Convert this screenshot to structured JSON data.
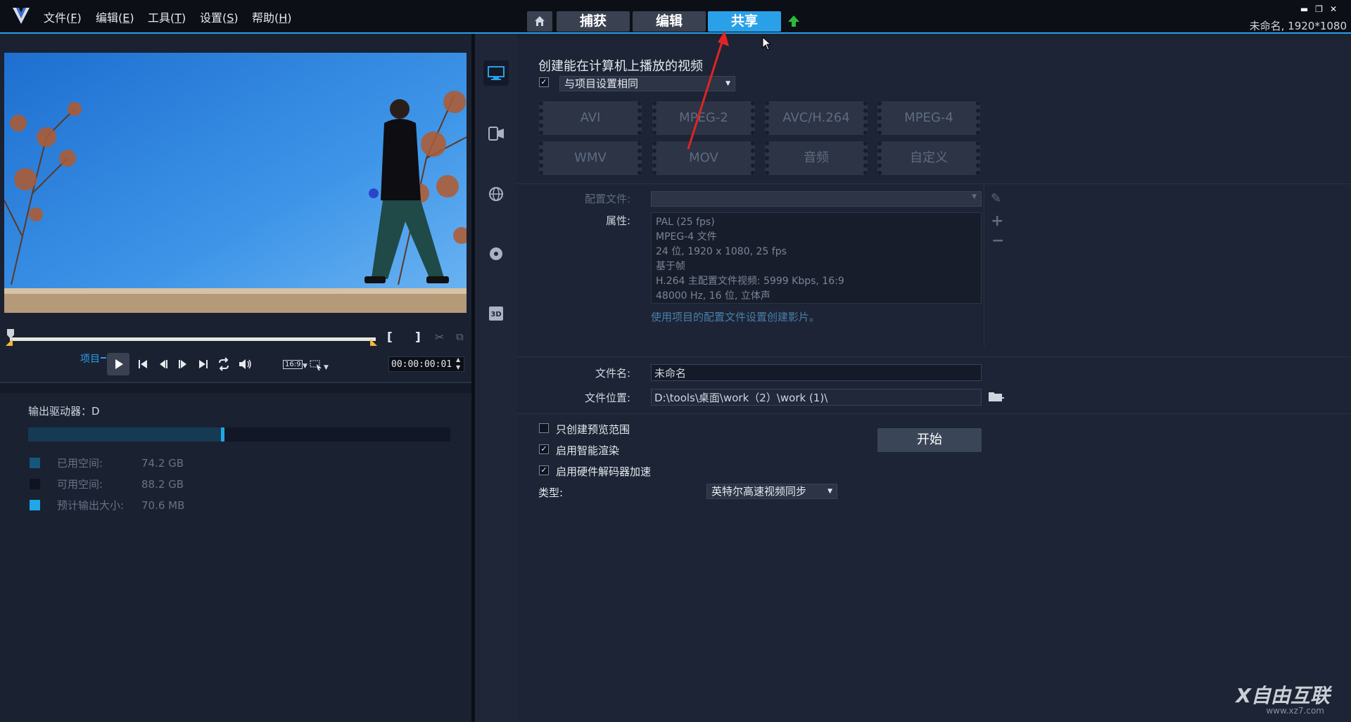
{
  "menu": [
    {
      "label": "文件(",
      "key": "F",
      "end": ")"
    },
    {
      "label": "编辑(",
      "key": "E",
      "end": ")"
    },
    {
      "label": "工具(",
      "key": "T",
      "end": ")"
    },
    {
      "label": "设置(",
      "key": "S",
      "end": ")"
    },
    {
      "label": "帮助(",
      "key": "H",
      "end": ")"
    }
  ],
  "tabs": {
    "capture": "捕获",
    "edit": "编辑",
    "share": "共享"
  },
  "project_info": "未命名, 1920*1080",
  "player": {
    "project_label": "项目",
    "aspect": "16:9",
    "timecode": "00:00:00:01"
  },
  "drive": {
    "title": "输出驱动器：D",
    "used_fraction": 0.457,
    "used_label": "已用空间:",
    "used_value": "74.2 GB",
    "free_label": "可用空间:",
    "free_value": "88.2 GB",
    "est_label": "预计输出大小:",
    "est_value": "70.6 MB"
  },
  "share": {
    "heading": "创建能在计算机上播放的视频",
    "same_as_project": "与项目设置相同",
    "formats": [
      "AVI",
      "MPEG-2",
      "AVC/H.264",
      "MPEG-4",
      "WMV",
      "MOV",
      "音频",
      "自定义"
    ],
    "profile_label": "配置文件:",
    "props_label": "属性:",
    "props": [
      "PAL (25 fps)",
      "MPEG-4 文件",
      "24 位, 1920 x 1080, 25 fps",
      "基于帧",
      "H.264 主配置文件视频: 5999 Kbps, 16:9",
      "48000 Hz, 16 位, 立体声"
    ],
    "props_hint": "使用项目的配置文件设置创建影片。",
    "filename_label": "文件名:",
    "filename_value": "未命名",
    "location_label": "文件位置:",
    "location_value": "D:\\tools\\桌面\\work（2）\\work (1)\\",
    "opt_preview_range": "只创建预览范围",
    "opt_smart_render": "启用智能渲染",
    "opt_hw_decode": "启用硬件解码器加速",
    "type_label": "类型:",
    "type_value": "英特尔高速视频同步",
    "start": "开始"
  },
  "watermark": "X自由互联",
  "watermark_url": "www.xz7.com",
  "colors": {
    "accent": "#2aa0e8",
    "upload_arrow": "#2bbb3a",
    "annotation_arrow": "#e02424"
  }
}
